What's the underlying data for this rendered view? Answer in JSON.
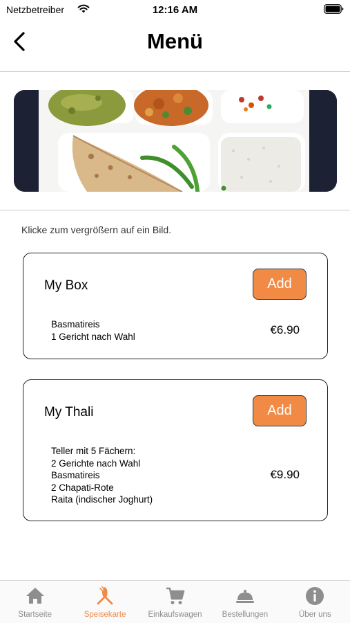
{
  "status_bar": {
    "carrier": "Netzbetreiber",
    "time": "12:16 AM"
  },
  "nav": {
    "title": "Menü"
  },
  "hint": "Klicke zum vergrößern auf ein Bild.",
  "colors": {
    "accent": "#f08a45",
    "tab_inactive": "#8e8e8e"
  },
  "menu_items": [
    {
      "title": "My Box",
      "add_label": "Add",
      "description": "Basmatireis\n1 Gericht nach Wahl",
      "price": "€6.90"
    },
    {
      "title": "My Thali",
      "add_label": "Add",
      "description": "Teller mit 5 Fächern:\n2 Gerichte nach Wahl\nBasmatireis\n2 Chapati-Rote\nRaita (indischer Joghurt)",
      "price": "€9.90"
    }
  ],
  "tabs": [
    {
      "label": "Startseite",
      "icon": "home-icon"
    },
    {
      "label": "Speisekarte",
      "icon": "fork-knife-icon",
      "active": true
    },
    {
      "label": "Einkaufswagen",
      "icon": "cart-icon"
    },
    {
      "label": "Bestellungen",
      "icon": "cloche-icon"
    },
    {
      "label": "Über uns",
      "icon": "info-icon"
    }
  ]
}
